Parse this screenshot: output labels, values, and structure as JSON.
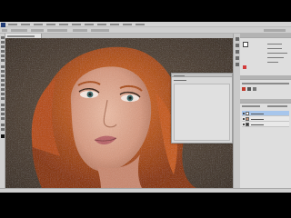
{
  "app": {
    "name": "Photoshop",
    "logo_icon": "photoshop-logo-icon"
  },
  "colors": {
    "chrome": "#cfcfcf",
    "panel": "#dedede",
    "layer_selected": "#a7c6ec",
    "hair": "#c85a1e",
    "skin": "#d8a58e",
    "background_photo": "#5a4a3a"
  },
  "menu": {
    "item_count": 11
  },
  "tools": {
    "icons": [
      "move-tool-icon",
      "marquee-tool-icon",
      "lasso-tool-icon",
      "quick-select-icon",
      "crop-tool-icon",
      "eyedropper-icon",
      "healing-brush-icon",
      "brush-tool-icon",
      "clone-stamp-icon",
      "history-brush-icon",
      "eraser-icon",
      "gradient-tool-icon",
      "blur-tool-icon",
      "dodge-tool-icon",
      "pen-tool-icon",
      "type-tool-icon",
      "path-select-icon",
      "shape-tool-icon",
      "hand-tool-icon",
      "zoom-tool-icon",
      "foreground-color-icon"
    ]
  },
  "document": {
    "tab_label": ""
  },
  "layers": {
    "items": [
      {
        "name": "",
        "selected": true
      },
      {
        "name": "",
        "selected": false
      },
      {
        "name": "",
        "selected": false
      }
    ]
  }
}
